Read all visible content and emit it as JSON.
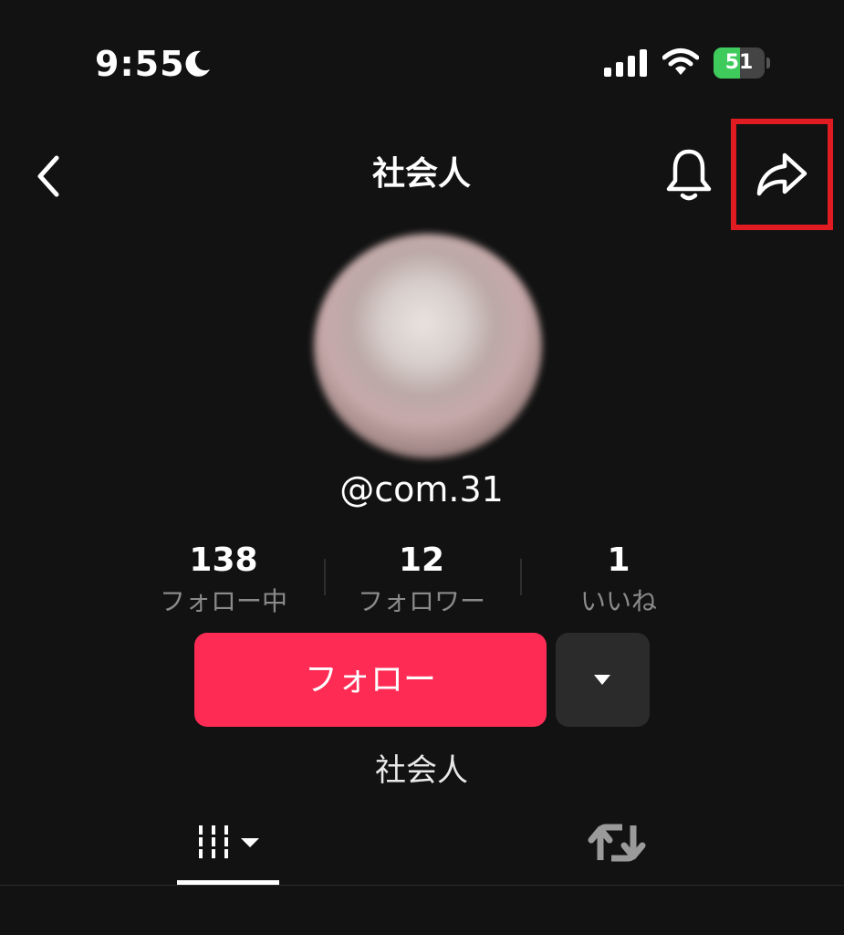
{
  "status_bar": {
    "time": "9:55",
    "battery_percent": "51",
    "battery_level": 0.51,
    "icons": [
      "moon-icon",
      "signal-icon",
      "wifi-icon",
      "battery-charging-icon"
    ]
  },
  "nav": {
    "title": "社会人",
    "icons": [
      "back-chevron-icon",
      "bell-icon",
      "share-arrow-icon"
    ],
    "highlight_color": "#e01b22"
  },
  "profile": {
    "handle": "@com.31",
    "bio": "社会人",
    "stats": [
      {
        "value": "138",
        "label": "フォロー中"
      },
      {
        "value": "12",
        "label": "フォロワー"
      },
      {
        "value": "1",
        "label": "いいね"
      }
    ]
  },
  "actions": {
    "follow_label": "フォロー",
    "follow_color": "#fe2c55"
  },
  "tabs": [
    {
      "icon": "grid-videos-icon",
      "active": true
    },
    {
      "icon": "repost-icon",
      "active": false
    }
  ]
}
